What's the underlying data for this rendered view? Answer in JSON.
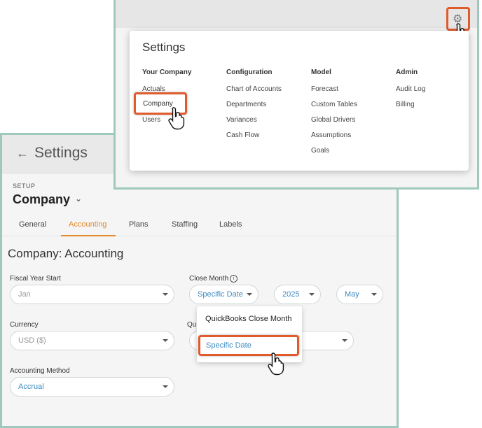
{
  "settings_page": {
    "back_icon": "arrow-left-icon",
    "title": "Settings",
    "setup_label": "SETUP",
    "company_select": "Company",
    "tabs": [
      {
        "label": "General",
        "active": false
      },
      {
        "label": "Accounting",
        "active": true
      },
      {
        "label": "Plans",
        "active": false
      },
      {
        "label": "Staffing",
        "active": false
      },
      {
        "label": "Labels",
        "active": false
      }
    ],
    "section_title": "Company: Accounting",
    "fields": {
      "fiscal_year_start": {
        "label": "Fiscal Year Start",
        "value": "Jan"
      },
      "close_month": {
        "label": "Close Month",
        "value": "Specific Date",
        "year": "2025",
        "month": "May"
      },
      "currency": {
        "label": "Currency",
        "value": "USD ($)"
      },
      "qb_partial_label": "Qu",
      "accounting_method": {
        "label": "Accounting Method",
        "value": "Accrual"
      }
    },
    "close_month_dropdown": {
      "options": [
        "QuickBooks Close Month",
        "Specific Date"
      ],
      "highlighted": "Specific Date"
    }
  },
  "settings_menu": {
    "title": "Settings",
    "columns": [
      {
        "heading": "Your Company",
        "items": [
          "Actuals",
          "Company",
          "Users"
        ]
      },
      {
        "heading": "Configuration",
        "items": [
          "Chart of Accounts",
          "Departments",
          "Variances",
          "Cash Flow"
        ]
      },
      {
        "heading": "Model",
        "items": [
          "Forecast",
          "Custom Tables",
          "Global Drivers",
          "Assumptions",
          "Goals"
        ]
      },
      {
        "heading": "Admin",
        "items": [
          "Audit Log",
          "Billing"
        ]
      }
    ],
    "highlighted_item": "Company"
  },
  "icons": {
    "gear": "gear-icon",
    "cursor": "hand-pointer-icon",
    "info": "info-icon"
  },
  "colors": {
    "highlight": "#e05a2b",
    "active_tab": "#e38a2b",
    "link_blue": "#3e8ac1",
    "panel_border": "#9fc9bd"
  }
}
